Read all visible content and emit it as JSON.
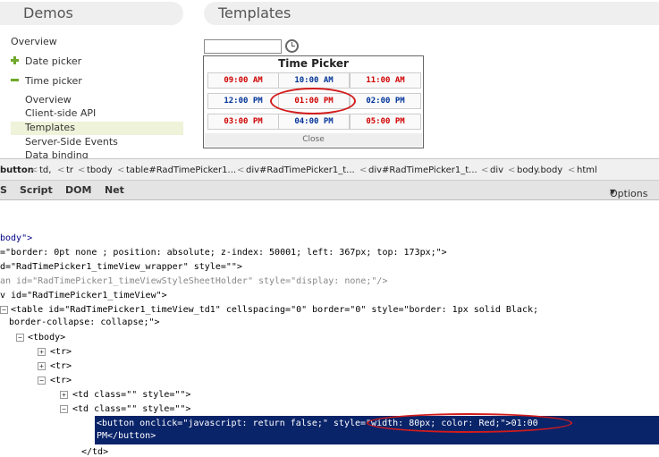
{
  "header": {
    "demos_label": "Demos",
    "templates_label": "Templates"
  },
  "nav": {
    "overview": "Overview",
    "date_picker": "Date picker",
    "time_picker": "Time picker",
    "sub_items": [
      "Overview",
      "Client-side API",
      "Templates",
      "Server-Side Events",
      "Data binding"
    ]
  },
  "timepicker": {
    "title": "Time Picker",
    "times": [
      {
        "t": "09:00 AM",
        "c": "red"
      },
      {
        "t": "10:00 AM",
        "c": "blue"
      },
      {
        "t": "11:00 AM",
        "c": "red"
      },
      {
        "t": "12:00 PM",
        "c": "blue"
      },
      {
        "t": "01:00 PM",
        "c": "red"
      },
      {
        "t": "02:00 PM",
        "c": "blue"
      },
      {
        "t": "03:00 PM",
        "c": "red"
      },
      {
        "t": "04:00 PM",
        "c": "blue"
      },
      {
        "t": "05:00 PM",
        "c": "red"
      }
    ],
    "close": "Close"
  },
  "devtools": {
    "breadcrumbs": [
      "button",
      "td,",
      "tr",
      "tbody",
      "table#RadTimePicker1...",
      "div#RadTimePicker1_t...",
      "div#RadTimePicker1_t...",
      "div",
      "body.body",
      "html"
    ],
    "tabs": [
      "S",
      "Script",
      "DOM",
      "Net"
    ],
    "options": "Options",
    "lines": {
      "l1": "body\">",
      "l2a": "=\"border: 0pt none ; position: absolute; z-index: 50001; left: 367px; top: 173px;\">",
      "l3a": "d=\"RadTimePicker1_timeView_wrapper\" style=\"\">",
      "l4a": "an id=\"RadTimePicker1_timeViewStyleSheetHolder\" style=\"display: none;\"/>",
      "l5a": "v id=\"RadTimePicker1_timeView\">",
      "l6a": "<table id=\"RadTimePicker1_timeView_td1\" cellspacing=\"0\" border=\"0\" style=\"border: 1px solid Black;",
      "l6b": "border-collapse: collapse;\">",
      "tbody": "<tbody>",
      "tr1": "<tr>",
      "tr2": "<tr>",
      "tr3": "<tr>",
      "td1": "<td class=\"\" style=\"\">",
      "td2": "<td class=\"\" style=\"\">",
      "btn1": "<button onclick=\"javascript: return false;\" style=\"width: 80px; color: Red;\">01:00",
      "btn2": "PM</button>",
      "tdclose": "</td>"
    }
  }
}
